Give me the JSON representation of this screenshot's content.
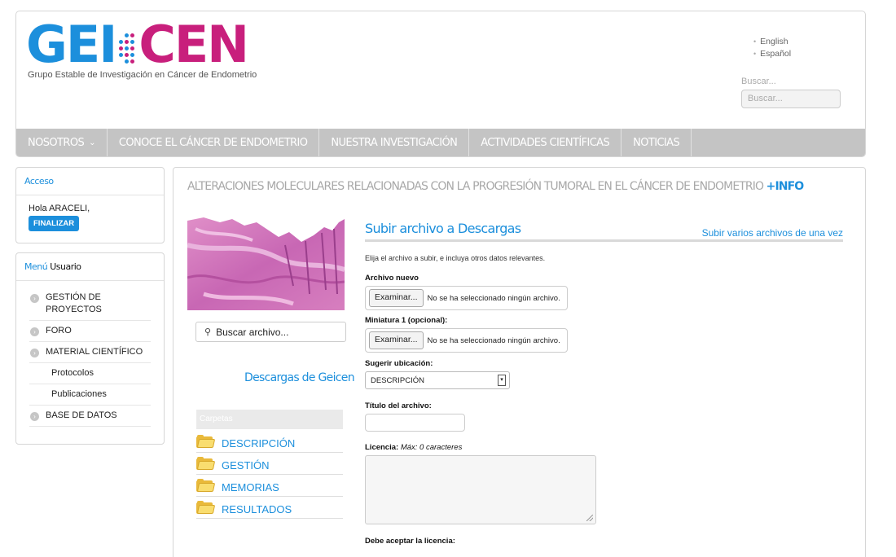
{
  "header": {
    "logo": {
      "part1": "GEI",
      "part2": "CEN",
      "tagline": "Grupo Estable de Investigación en Cáncer de Endometrio"
    },
    "languages": [
      "English",
      "Español"
    ],
    "search": {
      "label": "Buscar...",
      "placeholder": "Buscar..."
    }
  },
  "nav": {
    "items": [
      {
        "label": "NOSOTROS",
        "caret": "⌄"
      },
      {
        "label": "CONOCE EL CÁNCER DE ENDOMETRIO"
      },
      {
        "label": "NUESTRA INVESTIGACIÓN"
      },
      {
        "label": "ACTIVIDADES CIENTÍFICAS"
      },
      {
        "label": "NOTICIAS"
      }
    ]
  },
  "sidebar": {
    "access": {
      "title": "Acceso",
      "greeting": "Hola ARACELI,",
      "logout_label": "FINALIZAR"
    },
    "menu": {
      "title_part1": "Menú",
      "title_part2": "Usuario",
      "items": [
        {
          "label": "GESTIÓN DE PROYECTOS",
          "icon": "arrow-circle-icon"
        },
        {
          "label": "FORO",
          "icon": "arrow-circle-icon"
        },
        {
          "label": "MATERIAL CIENTÍFICO",
          "icon": "arrow-circle-icon"
        },
        {
          "label": "Protocolos"
        },
        {
          "label": "Publicaciones"
        },
        {
          "label": "BASE DE DATOS",
          "icon": "arrow-circle-icon"
        }
      ]
    }
  },
  "main": {
    "title": "ALTERACIONES MOLECULARES RELACIONADAS CON LA PROGRESIÓN TUMORAL EN EL CÁNCER DE ENDOMETRIO",
    "more_link": "+INFO",
    "file_search_placeholder": "Buscar archivo...",
    "downloads_title": "Descargas de Geicen",
    "folders": {
      "header": "Carpetas",
      "items": [
        "DESCRIPCIÓN",
        "GESTIÓN",
        "MEMORIAS",
        "RESULTADOS"
      ]
    },
    "form": {
      "title": "Subir archivo a Descargas",
      "multi_upload_link": "Subir varios archivos de una vez",
      "intro": "Elija el archivo a subir, e incluya otros datos relevantes.",
      "new_file_label": "Archivo nuevo",
      "browse_label": "Examinar...",
      "no_file_text": "No se ha seleccionado ningún archivo.",
      "thumbnail_label": "Miniatura 1 (opcional):",
      "location_label": "Sugerir ubicación:",
      "location_value": "DESCRIPCIÓN",
      "file_title_label": "Título del archivo:",
      "license_label": "Licencia:",
      "license_note": "Máx: 0 caracteres",
      "accept_license_label": "Debe aceptar la licencia:"
    }
  },
  "colors": {
    "brand_blue": "#1c8fdc",
    "brand_magenta": "#c81f7c",
    "nav_gray": "#c4c4c4"
  }
}
